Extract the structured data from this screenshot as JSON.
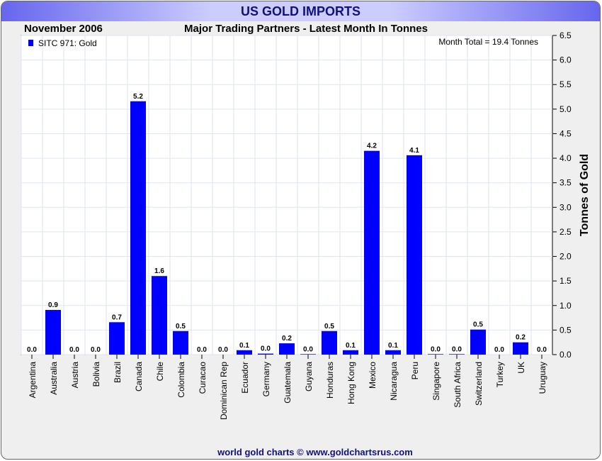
{
  "banner_title": "US GOLD IMPORTS",
  "footer": "world gold charts © www.goldchartsrus.com",
  "colors": {
    "bar": "#0000ff",
    "grid": "#dde6f0"
  },
  "chart_data": {
    "type": "bar",
    "title": "Major Trading Partners - Latest Month In Tonnes",
    "period": "November 2006",
    "legend": "SITC 971: Gold",
    "legend_position": "top-left",
    "annotation": "Month Total = 19.4 Tonnes",
    "ylabel": "Tonnes of Gold",
    "ylim": [
      0,
      6.5
    ],
    "yticks": [
      "0.0",
      "0.5",
      "1.0",
      "1.5",
      "2.0",
      "2.5",
      "3.0",
      "3.5",
      "4.0",
      "4.5",
      "5.0",
      "5.5",
      "6.0",
      "6.5"
    ],
    "categories": [
      "Argentina",
      "Australia",
      "Austria",
      "Bolivia",
      "Brazil",
      "Canada",
      "Chile",
      "Colombia",
      "Curacao",
      "Dominican Rep",
      "Ecuador",
      "Germany",
      "Guatemala",
      "Guyana",
      "Honduras",
      "Hong Kong",
      "Mexico",
      "Nicaragua",
      "Peru",
      "Singapore",
      "South Africa",
      "Switzerland",
      "Turkey",
      "UK",
      "Uruguay"
    ],
    "values": [
      0.0,
      0.91,
      0.0,
      0.0,
      0.66,
      5.16,
      1.6,
      0.48,
      0.0,
      0.0,
      0.09,
      0.02,
      0.23,
      0.01,
      0.48,
      0.09,
      4.15,
      0.09,
      4.06,
      0.01,
      0.01,
      0.51,
      0.0,
      0.25,
      0.0
    ],
    "labels": [
      "0.0",
      "0.9",
      "0.0",
      "0.0",
      "0.7",
      "5.2",
      "1.6",
      "0.5",
      "0.0",
      "0.0",
      "0.1",
      "0.0",
      "0.2",
      "0.0",
      "0.5",
      "0.1",
      "4.2",
      "0.1",
      "4.1",
      "0.0",
      "0.0",
      "0.5",
      "0.0",
      "0.2",
      "0.0"
    ]
  }
}
